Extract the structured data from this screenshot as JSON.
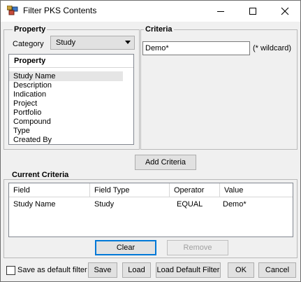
{
  "window": {
    "title": "Filter PKS Contents"
  },
  "property": {
    "group_label": "Property",
    "category_label": "Category",
    "category_value": "Study",
    "list_header": "Property",
    "items": [
      "Study Name",
      "Description",
      "Indication",
      "Project",
      "Portfolio",
      "Compound",
      "Type",
      "Created By"
    ],
    "selected_index": 0
  },
  "criteria": {
    "group_label": "Criteria",
    "input_value": "Demo*",
    "hint": "(* wildcard)"
  },
  "add_criteria_label": "Add Criteria",
  "current_criteria": {
    "group_label": "Current Criteria",
    "columns": [
      "Field",
      "Field Type",
      "Operator",
      "Value"
    ],
    "rows": [
      {
        "field": "Study Name",
        "field_type": "Study",
        "operator": "EQUAL",
        "value": "Demo*"
      }
    ],
    "clear_label": "Clear",
    "remove_label": "Remove"
  },
  "footer": {
    "save_default_label": "Save as default filter",
    "save_label": "Save",
    "load_label": "Load",
    "load_default_label": "Load Default Filter",
    "ok_label": "OK",
    "cancel_label": "Cancel"
  },
  "colors": {
    "selection": "#e5e5e5",
    "accent": "#0078d7"
  },
  "icons": [
    "app-icon",
    "minimize-icon",
    "maximize-icon",
    "close-icon",
    "dropdown-arrow-icon"
  ]
}
